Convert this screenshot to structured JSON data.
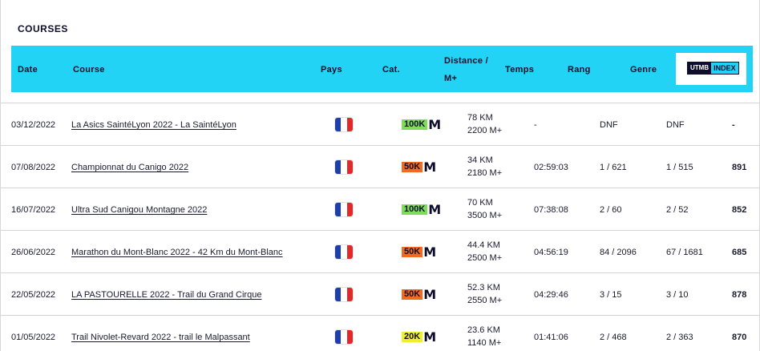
{
  "section_title": "COURSES",
  "columns": {
    "date": "Date",
    "course": "Course",
    "pays": "Pays",
    "cat": "Cat.",
    "distance_line1": "Distance /",
    "distance_line2": "M+",
    "temps": "Temps",
    "rang": "Rang",
    "genre": "Genre",
    "utmb_left": "UTMB",
    "utmb_right": "INDEX"
  },
  "colors": {
    "header": "#22d3f5",
    "cat_100k": "#7ddc5a",
    "cat_50k": "#f26a22",
    "cat_20k": "#f2ee2a",
    "flag_blue": "#1f3fa8",
    "flag_white": "#ffffff",
    "flag_red": "#e02a2a"
  },
  "rows": [
    {
      "date": "03/12/2022",
      "course": "La Asics SaintéLyon 2022 - La SaintéLyon",
      "flag": "france-flag-icon",
      "cat": "100K",
      "cat_color": "#7ddc5a",
      "distance": "78 KM",
      "elevation": "2200 M+",
      "temps": "-",
      "rang": "DNF",
      "genre": "DNF",
      "index": "-"
    },
    {
      "date": "07/08/2022",
      "course": "Championnat du Canigo 2022",
      "flag": "france-flag-icon",
      "cat": "50K",
      "cat_color": "#f26a22",
      "distance": "34 KM",
      "elevation": "2180 M+",
      "temps": "02:59:03",
      "rang": "1 / 621",
      "genre": "1 / 515",
      "index": "891"
    },
    {
      "date": "16/07/2022",
      "course": "Ultra Sud Canigou Montagne 2022",
      "flag": "france-flag-icon",
      "cat": "100K",
      "cat_color": "#7ddc5a",
      "distance": "70 KM",
      "elevation": "3500 M+",
      "temps": "07:38:08",
      "rang": "2 / 60",
      "genre": "2 / 52",
      "index": "852"
    },
    {
      "date": "26/06/2022",
      "course": "Marathon du Mont-Blanc 2022 - 42 Km du Mont-Blanc",
      "flag": "france-flag-icon",
      "cat": "50K",
      "cat_color": "#f26a22",
      "distance": "44.4 KM",
      "elevation": "2500 M+",
      "temps": "04:56:19",
      "rang": "84 / 2096",
      "genre": "67 / 1681",
      "index": "685"
    },
    {
      "date": "22/05/2022",
      "course": "LA PASTOURELLE 2022 - Trail du Grand Cirque",
      "flag": "france-flag-icon",
      "cat": "50K",
      "cat_color": "#f26a22",
      "distance": "52.3 KM",
      "elevation": "2550 M+",
      "temps": "04:29:46",
      "rang": "3 / 15",
      "genre": "3 / 10",
      "index": "878"
    },
    {
      "date": "01/05/2022",
      "course": "Trail Nivolet-Revard 2022 - trail le Malpassant",
      "flag": "france-flag-icon",
      "cat": "20K",
      "cat_color": "#f2ee2a",
      "distance": "23.6 KM",
      "elevation": "1140 M+",
      "temps": "01:41:06",
      "rang": "2 / 468",
      "genre": "2 / 363",
      "index": "870"
    }
  ]
}
